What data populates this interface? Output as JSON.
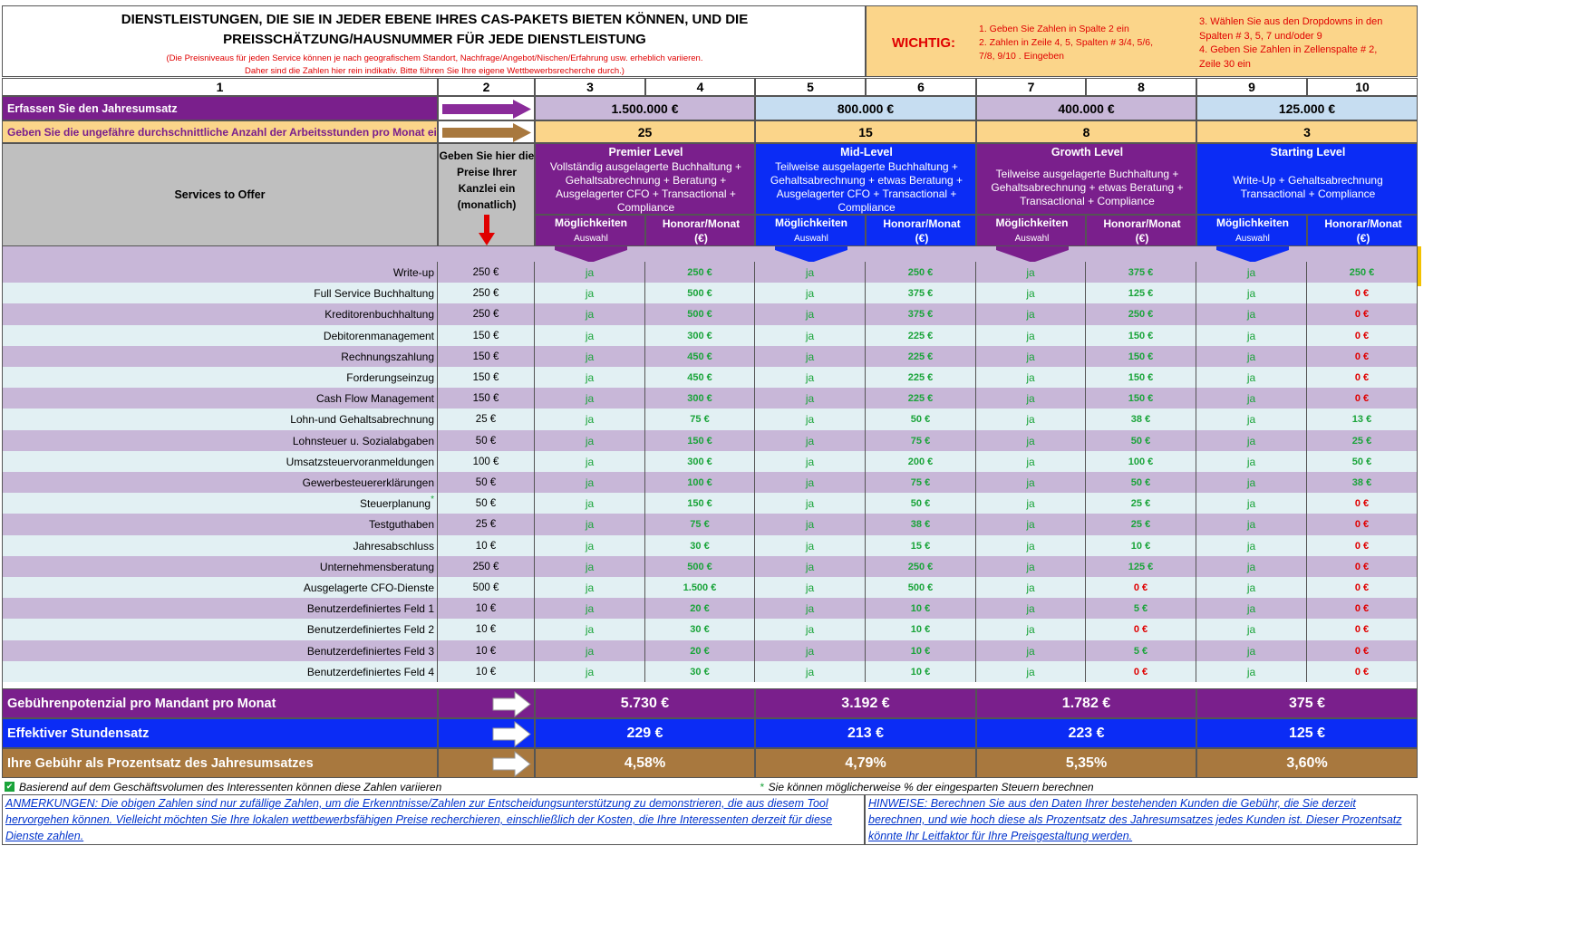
{
  "header": {
    "title": "DIENSTLEISTUNGEN, DIE SIE IN JEDER EBENE IHRES CAS-PAKETS BIETEN KÖNNEN, UND DIE PREISSCHÄTZUNG/HAUSNUMMER FÜR JEDE DIENSTLEISTUNG",
    "subtitle_line1": "(Die Preisniveaus für jeden Service können je nach geografischem Standort, Nachfrage/Angebot/Nischen/Erfahrung usw. erheblich variieren.",
    "subtitle_line2": "Daher sind die Zahlen hier rein indikativ. Bitte führen Sie Ihre eigene Wettbewerbsrecherche durch.)",
    "important_label": "WICHTIG:",
    "important_left": [
      "1. Geben Sie Zahlen in Spalte 2 ein",
      "2. Zahlen in Zeile 4, 5, Spalten # 3/4, 5/6,",
      "7/8, 9/10 . Eingeben"
    ],
    "important_right": [
      "3. Wählen Sie aus den Dropdowns in den",
      "Spalten # 3, 5, 7 und/oder 9",
      "4. Geben Sie Zahlen in Zellenspalte # 2,",
      "Zeile 30 ein"
    ]
  },
  "column_numbers": [
    "1",
    "2",
    "3",
    "4",
    "5",
    "6",
    "7",
    "8",
    "9",
    "10"
  ],
  "rows_top": {
    "revenue_label": "Erfassen Sie den Jahresumsatz",
    "revenues": [
      "1.500.000 €",
      "800.000 €",
      "400.000 €",
      "125.000 €"
    ],
    "hours_label": "Geben Sie die ungefähre durchschnittliche Anzahl der Arbeitsstunden pro Monat ein",
    "hours": [
      "25",
      "15",
      "8",
      "3"
    ]
  },
  "services_header": "Services to Offer",
  "col2_header": "Geben Sie hier die Preise Ihrer Kanzlei ein (monatlich)",
  "levels": [
    {
      "name": "Premier Level",
      "desc": "Vollständig ausgelagerte Buchhaltung + Gehaltsabrechnung + Beratung + Ausgelagerter CFO + Transactional + Compliance",
      "color": "#7a1f8c"
    },
    {
      "name": "Mid-Level",
      "desc": "Teilweise ausgelagerte Buchhaltung + Gehaltsabrechnung + etwas Beratung + Ausgelagerter CFO + Transactional + Compliance",
      "color": "#0b2cf5"
    },
    {
      "name": "Growth Level",
      "desc": "Teilweise ausgelagerte Buchhaltung + Gehaltsabrechnung + etwas Beratung + Transactional + Compliance",
      "color": "#7a1f8c"
    },
    {
      "name": "Starting Level",
      "desc": "Write-Up + Gehaltsabrechnung Transactional + Compliance",
      "color": "#0b2cf5"
    }
  ],
  "sub_headers": {
    "moeglichkeiten": "Möglichkeiten",
    "auswahl": "Auswahl",
    "honorar_line1": "Honorar/Monat",
    "honorar_line2": "(€)"
  },
  "services": [
    {
      "name": "Write-up",
      "price": "250 €",
      "fees": [
        "250 €",
        "250 €",
        "375 €",
        "250 €"
      ]
    },
    {
      "name": "Full Service Buchhaltung",
      "price": "250 €",
      "fees": [
        "500 €",
        "375 €",
        "125 €",
        "0 €"
      ]
    },
    {
      "name": "Kreditorenbuchhaltung",
      "price": "250 €",
      "fees": [
        "500 €",
        "375 €",
        "250 €",
        "0 €"
      ]
    },
    {
      "name": "Debitorenmanagement",
      "price": "150 €",
      "fees": [
        "300 €",
        "225 €",
        "150 €",
        "0 €"
      ]
    },
    {
      "name": "Rechnungszahlung",
      "price": "150 €",
      "fees": [
        "450 €",
        "225 €",
        "150 €",
        "0 €"
      ]
    },
    {
      "name": "Forderungseinzug",
      "price": "150 €",
      "fees": [
        "450 €",
        "225 €",
        "150 €",
        "0 €"
      ]
    },
    {
      "name": "Cash Flow Management",
      "price": "150 €",
      "fees": [
        "300 €",
        "225 €",
        "150 €",
        "0 €"
      ]
    },
    {
      "name": "Lohn-und Gehaltsabrechnung",
      "price": "25 €",
      "fees": [
        "75 €",
        "50 €",
        "38 €",
        "13 €"
      ]
    },
    {
      "name": "Lohnsteuer u. Sozialabgaben",
      "price": "50 €",
      "fees": [
        "150 €",
        "75 €",
        "50 €",
        "25 €"
      ]
    },
    {
      "name": "Umsatzsteuervoranmeldungen",
      "price": "100 €",
      "fees": [
        "300 €",
        "200 €",
        "100 €",
        "50 €"
      ]
    },
    {
      "name": "Gewerbesteuererklärungen",
      "price": "50 €",
      "fees": [
        "100 €",
        "75 €",
        "50 €",
        "38 €"
      ]
    },
    {
      "name": "Steuerplanung",
      "price": "50 €",
      "fees": [
        "150 €",
        "50 €",
        "25 €",
        "0 €"
      ]
    },
    {
      "name": "Testguthaben",
      "price": "25 €",
      "fees": [
        "75 €",
        "38 €",
        "25 €",
        "0 €"
      ]
    },
    {
      "name": "Jahresabschluss",
      "price": "10 €",
      "fees": [
        "30 €",
        "15 €",
        "10 €",
        "0 €"
      ]
    },
    {
      "name": "Unternehmensberatung",
      "price": "250 €",
      "fees": [
        "500 €",
        "250 €",
        "125 €",
        "0 €"
      ]
    },
    {
      "name": "Ausgelagerte CFO-Dienste",
      "price": "500 €",
      "fees": [
        "1.500 €",
        "500 €",
        "0 €",
        "0 €"
      ]
    },
    {
      "name": "Benutzerdefiniertes Feld 1",
      "price": "10 €",
      "fees": [
        "20 €",
        "10 €",
        "5 €",
        "0 €"
      ]
    },
    {
      "name": "Benutzerdefiniertes Feld 2",
      "price": "10 €",
      "fees": [
        "30 €",
        "10 €",
        "0 €",
        "0 €"
      ]
    },
    {
      "name": "Benutzerdefiniertes Feld 3",
      "price": "10 €",
      "fees": [
        "20 €",
        "10 €",
        "5 €",
        "0 €"
      ]
    },
    {
      "name": "Benutzerdefiniertes Feld 4",
      "price": "10 €",
      "fees": [
        "30 €",
        "10 €",
        "0 €",
        "0 €"
      ]
    }
  ],
  "option_value": "ja",
  "steuer_mark": "*",
  "totals": [
    {
      "label": "Gebührenpotenzial pro Mandant pro Monat",
      "values": [
        "5.730 €",
        "3.192 €",
        "1.782 €",
        "375 €"
      ],
      "color": "#7a1f8c"
    },
    {
      "label": "Effektiver Stundensatz",
      "values": [
        "229 €",
        "213 €",
        "223 €",
        "125 €"
      ],
      "color": "#0b2cf5"
    },
    {
      "label": "Ihre Gebühr als Prozentsatz des Jahresumsatzes",
      "values": [
        "4,58%",
        "4,79%",
        "5,35%",
        "3,60%"
      ],
      "color": "#a8783e"
    }
  ],
  "footnotes": {
    "left": "Basierend auf dem Geschäftsvolumen des Interessenten können diese Zahlen variieren",
    "right_mark": "*",
    "right": "Sie können möglicherweise % der eingesparten Steuern berechnen"
  },
  "notes": {
    "left": "ANMERKUNGEN: Die obigen Zahlen sind nur zufällige Zahlen, um die Erkenntnisse/Zahlen zur Entscheidungsunterstützung zu demonstrieren, die aus diesem Tool hervorgehen können. Vielleicht möchten Sie Ihre lokalen wettbewerbsfähigen Preise recherchieren, einschließlich der Kosten, die Ihre Interessenten derzeit für diese Dienste zahlen.",
    "right": "HINWEISE: Berechnen Sie aus den Daten Ihrer bestehenden Kunden die Gebühr, die Sie derzeit berechnen, und wie hoch diese als Prozentsatz des Jahresumsatzes jedes Kunden ist. Dieser Prozentsatz könnte Ihr Leitfaktor für Ihre Preisgestaltung werden."
  }
}
